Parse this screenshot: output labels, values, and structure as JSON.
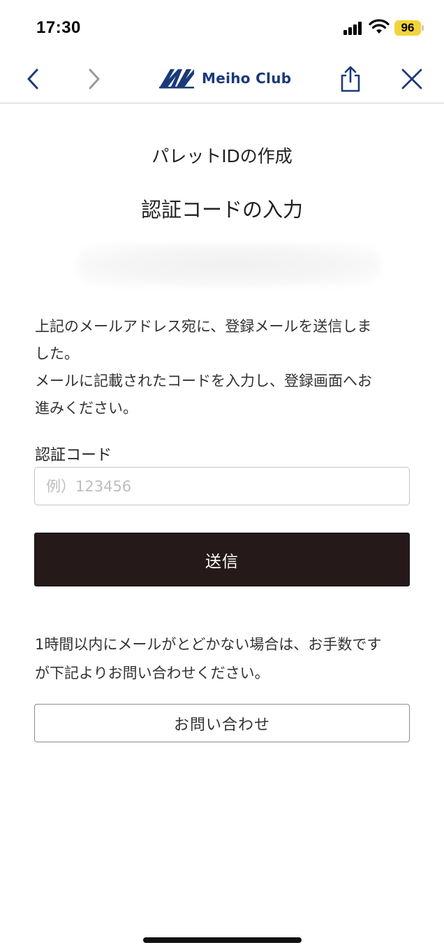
{
  "status_bar": {
    "time": "17:30",
    "battery": "96",
    "icons": [
      "signal-icon",
      "wifi-icon",
      "battery-icon"
    ]
  },
  "nav": {
    "brand_name": "Meiho Club",
    "icons": [
      "chevron-left-icon",
      "chevron-right-icon",
      "share-icon",
      "close-icon"
    ],
    "colors": {
      "active": "#1a3a78",
      "disabled": "#9a9a9a"
    }
  },
  "header": {
    "subtitle": "パレットIDの作成",
    "title": "認証コードの入力"
  },
  "message": {
    "line1": "上記のメールアドレス宛に、登録メールを送信しま\nした。",
    "line2": "メールに記載されたコードを入力し、登録画面へお\n進みください。"
  },
  "form": {
    "code_label": "認証コード",
    "code_value": "",
    "code_placeholder": "例）123456",
    "submit_label": "送信"
  },
  "notice": {
    "text": "1時間以内にメールがとどかない場合は、お手数です\nが下記よりお問い合わせください。"
  },
  "contact": {
    "label": "お問い合わせ"
  },
  "colors": {
    "submit_bg": "#251a19",
    "brand": "#1a3a78",
    "battery": "#f2d43a"
  }
}
